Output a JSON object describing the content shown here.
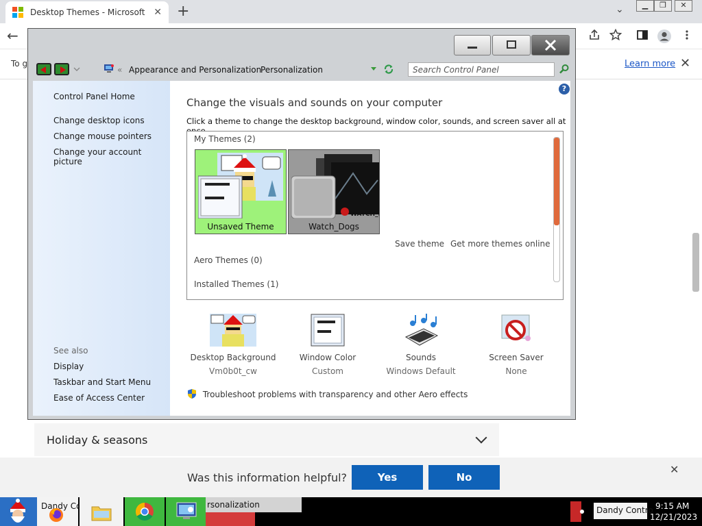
{
  "browser": {
    "tab_title": "Desktop Themes - Microsoft Sup",
    "close_glyph": "✕",
    "new_tab_glyph": "+",
    "dropdown_glyph": "⌄",
    "minimize_glyph": "▁",
    "restore_glyph": "❐",
    "close_window_glyph": "✕",
    "back_glyph": "←",
    "infobar_text": "To g",
    "learn_more": "Learn more",
    "infobar_close": "✕"
  },
  "window": {
    "address": {
      "crumb_1": "Appearance and Personalization",
      "crumb_2": "Personalization",
      "separator": "«",
      "search_placeholder": "Search Control Panel"
    },
    "left_nav": {
      "home": "Control Panel Home",
      "links": [
        "Change desktop icons",
        "Change mouse pointers",
        "Change your account picture"
      ],
      "see_also": "See also",
      "see_also_links": [
        "Display",
        "Taskbar and Start Menu",
        "Ease of Access Center"
      ]
    },
    "help_glyph": "?",
    "title": "Change the visuals and sounds on your computer",
    "subtitle": "Click a theme to change the desktop background, window color, sounds, and screen saver all at once.",
    "themes": {
      "my_themes_label": "My Themes (2)",
      "tiles": [
        "Unsaved Theme",
        "Watch_Dogs"
      ],
      "save_theme": "Save theme",
      "get_more": "Get more themes online",
      "aero_label": "Aero Themes (0)",
      "installed_label": "Installed Themes (1)"
    },
    "bottom": [
      {
        "label": "Desktop Background",
        "value": "Vm0b0t_cw"
      },
      {
        "label": "Window Color",
        "value": "Custom"
      },
      {
        "label": "Sounds",
        "value": "Windows Default"
      },
      {
        "label": "Screen Saver",
        "value": "None"
      }
    ],
    "aero_link": "Troubleshoot problems with transparency and other Aero effects"
  },
  "page": {
    "accordion_title": "Holiday & seasons",
    "feedback_question": "Was this information helpful?",
    "yes": "Yes",
    "no": "No",
    "feedback_close": "✕"
  },
  "taskbar": {
    "item_control": "Dandy Contro",
    "item_personalization": "rsonalization",
    "item_right": "Dandy Contro",
    "time": "9:15 AM",
    "date": "12/21/2023"
  },
  "colors": {
    "accent_blue": "#0f62b8",
    "theme_selected": "#9ef27a",
    "scroll_thumb": "#e06a3c"
  }
}
